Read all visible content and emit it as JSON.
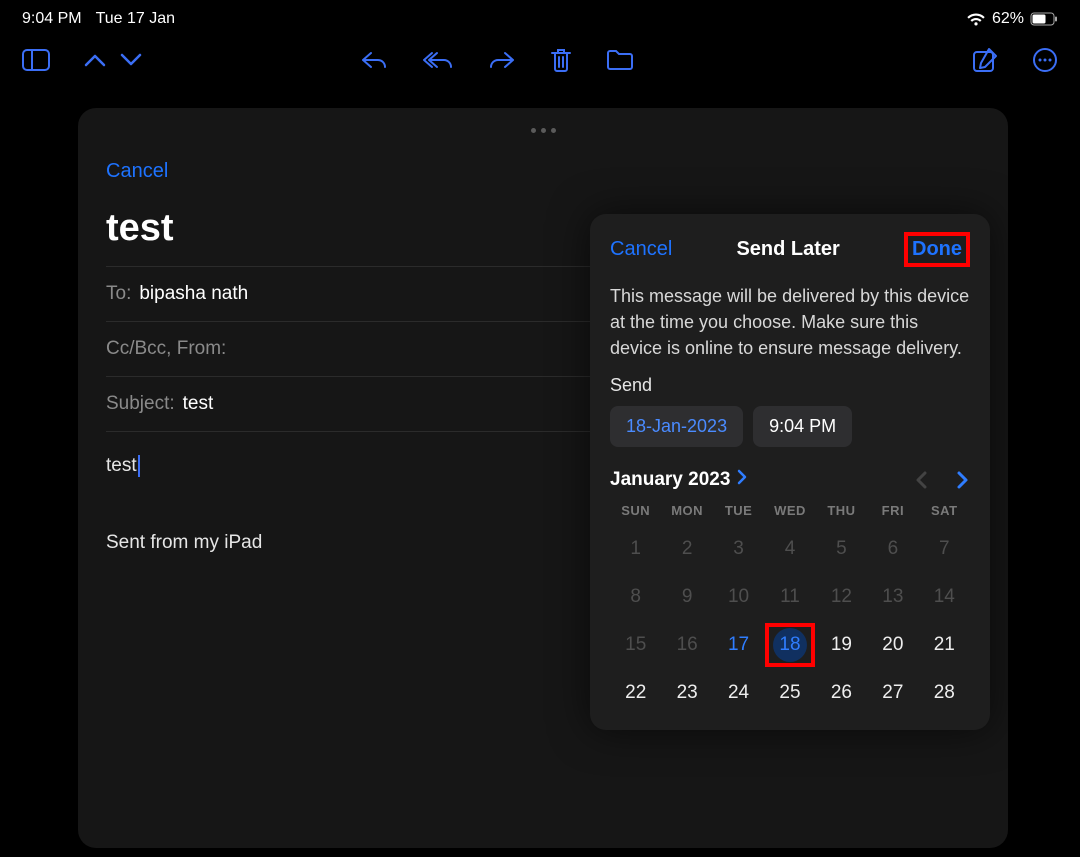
{
  "status": {
    "time": "9:04 PM",
    "date": "Tue 17 Jan",
    "battery": "62%"
  },
  "compose": {
    "cancel": "Cancel",
    "subjectTitle": "test",
    "to_label": "To:",
    "to_value": "bipasha nath",
    "ccbcc_label": "Cc/Bcc, From:",
    "subject_label": "Subject:",
    "subject_value": "test",
    "body_line1": "test",
    "signature": "Sent from my iPad"
  },
  "popover": {
    "cancel": "Cancel",
    "title": "Send Later",
    "done": "Done",
    "description": "This message will be delivered by this device at the time you choose. Make sure this device is online to ensure message delivery.",
    "send_label": "Send",
    "date_chip": "18-Jan-2023",
    "time_chip": "9:04 PM",
    "month": "January 2023",
    "dow": [
      "SUN",
      "MON",
      "TUE",
      "WED",
      "THU",
      "FRI",
      "SAT"
    ],
    "weeks": [
      [
        {
          "d": "1",
          "dim": true
        },
        {
          "d": "2",
          "dim": true
        },
        {
          "d": "3",
          "dim": true
        },
        {
          "d": "4",
          "dim": true
        },
        {
          "d": "5",
          "dim": true
        },
        {
          "d": "6",
          "dim": true
        },
        {
          "d": "7",
          "dim": true
        }
      ],
      [
        {
          "d": "8",
          "dim": true
        },
        {
          "d": "9",
          "dim": true
        },
        {
          "d": "10",
          "dim": true
        },
        {
          "d": "11",
          "dim": true
        },
        {
          "d": "12",
          "dim": true
        },
        {
          "d": "13",
          "dim": true
        },
        {
          "d": "14",
          "dim": true
        }
      ],
      [
        {
          "d": "15",
          "dim": true
        },
        {
          "d": "16",
          "dim": true
        },
        {
          "d": "17",
          "today": true
        },
        {
          "d": "18",
          "selected": true
        },
        {
          "d": "19"
        },
        {
          "d": "20"
        },
        {
          "d": "21"
        }
      ],
      [
        {
          "d": "22"
        },
        {
          "d": "23"
        },
        {
          "d": "24"
        },
        {
          "d": "25"
        },
        {
          "d": "26"
        },
        {
          "d": "27"
        },
        {
          "d": "28"
        }
      ]
    ]
  }
}
